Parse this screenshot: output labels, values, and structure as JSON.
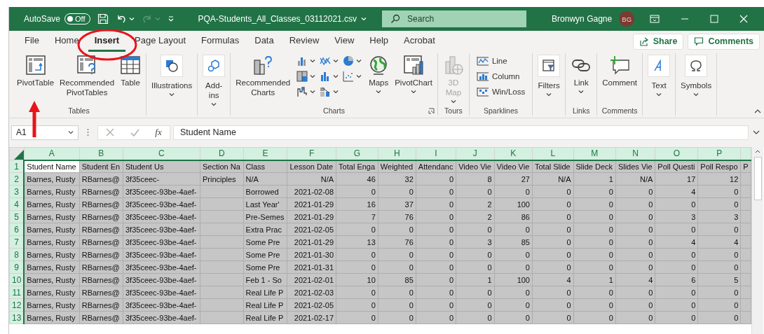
{
  "title_bar": {
    "autosave_label": "AutoSave",
    "autosave_toggle": {
      "label": "Off",
      "on": false
    },
    "filename": "PQA-Students_All_Classes_03112021.csv",
    "search": {
      "placeholder": "Search"
    },
    "user_name": "Bronwyn Gagne",
    "avatar_initials": "BG"
  },
  "tabs": [
    {
      "label": "File",
      "selected": false
    },
    {
      "label": "Home",
      "selected": false
    },
    {
      "label": "Insert",
      "selected": true
    },
    {
      "label": "Page Layout",
      "selected": false
    },
    {
      "label": "Formulas",
      "selected": false
    },
    {
      "label": "Data",
      "selected": false
    },
    {
      "label": "Review",
      "selected": false
    },
    {
      "label": "View",
      "selected": false
    },
    {
      "label": "Help",
      "selected": false
    },
    {
      "label": "Acrobat",
      "selected": false
    }
  ],
  "share_button": "Share",
  "comments_button": "Comments",
  "ribbon": {
    "groups": [
      {
        "label": "Tables",
        "items": [
          {
            "kind": "large",
            "label": "PivotTable",
            "dropdown": false,
            "disabled": false
          },
          {
            "kind": "large",
            "label": "Recommended PivotTables",
            "dropdown": false,
            "disabled": false
          },
          {
            "kind": "large",
            "label": "Table",
            "dropdown": false,
            "disabled": false
          }
        ]
      },
      {
        "items": [
          {
            "kind": "boxed",
            "label": "Illustrations",
            "dropdown": true,
            "disabled": false
          }
        ]
      },
      {
        "items": [
          {
            "kind": "boxed",
            "label": "Add-ins",
            "dropdown": true,
            "disabled": false
          }
        ]
      },
      {
        "label": "Charts",
        "launcher": true,
        "items": [
          {
            "kind": "large",
            "label": "Recommended Charts",
            "dropdown": false,
            "disabled": false
          },
          {
            "kind": "gallery"
          },
          {
            "kind": "large",
            "label": "Maps",
            "dropdown": true,
            "disabled": false
          },
          {
            "kind": "large",
            "label": "PivotChart",
            "dropdown": true,
            "disabled": false
          }
        ]
      },
      {
        "label": "Tours",
        "items": [
          {
            "kind": "large",
            "label": "3D Map",
            "dropdown": true,
            "disabled": true
          }
        ]
      },
      {
        "label": "Sparklines",
        "items": [
          {
            "kind": "small",
            "label": "Line"
          },
          {
            "kind": "small",
            "label": "Column"
          },
          {
            "kind": "small",
            "label": "Win/Loss"
          }
        ]
      },
      {
        "items": [
          {
            "kind": "boxed",
            "label": "Filters",
            "dropdown": true,
            "disabled": false
          }
        ]
      },
      {
        "label": "Links",
        "items": [
          {
            "kind": "large",
            "label": "Link",
            "dropdown": true,
            "disabled": false
          }
        ]
      },
      {
        "label": "Comments",
        "items": [
          {
            "kind": "large",
            "label": "Comment",
            "dropdown": false,
            "disabled": false
          }
        ]
      },
      {
        "items": [
          {
            "kind": "boxed",
            "label": "Text",
            "dropdown": true,
            "disabled": false
          }
        ]
      },
      {
        "items": [
          {
            "kind": "boxed",
            "label": "Symbols",
            "dropdown": true,
            "disabled": false
          }
        ]
      }
    ]
  },
  "formula_bar": {
    "name_box": "A1",
    "function_label": "fx",
    "value": "Student Name"
  },
  "grid": {
    "columns": [
      {
        "letter": "A",
        "selected": true,
        "active": true,
        "numeric": false
      },
      {
        "letter": "B",
        "selected": true,
        "active": false,
        "numeric": false
      },
      {
        "letter": "C",
        "selected": true,
        "active": false,
        "numeric": false
      },
      {
        "letter": "D",
        "selected": true,
        "active": false,
        "numeric": false
      },
      {
        "letter": "E",
        "selected": true,
        "active": false,
        "numeric": false
      },
      {
        "letter": "F",
        "selected": true,
        "active": false,
        "numeric": true
      },
      {
        "letter": "G",
        "selected": true,
        "active": false,
        "numeric": true
      },
      {
        "letter": "H",
        "selected": true,
        "active": false,
        "numeric": true
      },
      {
        "letter": "I",
        "selected": true,
        "active": false,
        "numeric": true
      },
      {
        "letter": "J",
        "selected": true,
        "active": false,
        "numeric": true
      },
      {
        "letter": "K",
        "selected": true,
        "active": false,
        "numeric": true
      },
      {
        "letter": "L",
        "selected": true,
        "active": false,
        "numeric": true
      },
      {
        "letter": "M",
        "selected": true,
        "active": false,
        "numeric": true
      },
      {
        "letter": "N",
        "selected": true,
        "active": false,
        "numeric": true
      },
      {
        "letter": "O",
        "selected": true,
        "active": false,
        "numeric": true
      },
      {
        "letter": "P",
        "selected": true,
        "active": false,
        "numeric": true
      },
      {
        "selected": true,
        "active": false
      }
    ],
    "rows": [
      {
        "number": "1",
        "selected": true,
        "active": true,
        "text_row": true,
        "cells": [
          "Student Name",
          "Student En",
          "Student Us",
          "Section Na",
          "Class",
          "Lesson Date",
          "Total Enga",
          "Weighted",
          "Attendanc",
          "Video Vie",
          "Video Vie",
          "Total Slide",
          "Slide Deck",
          "Slides Vie",
          "Poll Questi",
          "Poll Respo",
          "P"
        ]
      },
      {
        "number": "2",
        "selected": true,
        "active": false,
        "text_row": false,
        "cells": [
          "Barnes, Rusty",
          "RBarnes@",
          "3f35ceec-",
          "Principles",
          "N/A",
          "N/A",
          "46",
          "32",
          "0",
          "8",
          "27",
          "N/A",
          "1",
          "N/A",
          "17",
          "12"
        ]
      },
      {
        "number": "3",
        "selected": true,
        "active": false,
        "text_row": false,
        "cells": [
          "Barnes, Rusty",
          "RBarnes@",
          "3f35ceec-93be-4aef-",
          null,
          "Borrowed",
          "2021-02-08",
          "0",
          "0",
          "0",
          "0",
          "0",
          "0",
          "0",
          "0",
          "4",
          "0"
        ]
      },
      {
        "number": "4",
        "selected": true,
        "active": false,
        "text_row": false,
        "cells": [
          "Barnes, Rusty",
          "RBarnes@",
          "3f35ceec-93be-4aef-",
          null,
          "Last Year'",
          "2021-01-29",
          "16",
          "37",
          "0",
          "2",
          "100",
          "0",
          "0",
          "0",
          "0",
          "0"
        ]
      },
      {
        "number": "5",
        "selected": true,
        "active": false,
        "text_row": false,
        "cells": [
          "Barnes, Rusty",
          "RBarnes@",
          "3f35ceec-93be-4aef-",
          null,
          "Pre-Semes",
          "2021-01-29",
          "7",
          "76",
          "0",
          "2",
          "86",
          "0",
          "0",
          "0",
          "3",
          "3"
        ]
      },
      {
        "number": "6",
        "selected": true,
        "active": false,
        "text_row": false,
        "cells": [
          "Barnes, Rusty",
          "RBarnes@",
          "3f35ceec-93be-4aef-",
          null,
          "Extra Prac",
          "2021-02-05",
          "0",
          "0",
          "0",
          "0",
          "0",
          "0",
          "0",
          "0",
          "0",
          "0"
        ]
      },
      {
        "number": "7",
        "selected": true,
        "active": false,
        "text_row": false,
        "cells": [
          "Barnes, Rusty",
          "RBarnes@",
          "3f35ceec-93be-4aef-",
          null,
          "Some Pre",
          "2021-01-29",
          "13",
          "76",
          "0",
          "3",
          "85",
          "0",
          "0",
          "0",
          "4",
          "4"
        ]
      },
      {
        "number": "8",
        "selected": true,
        "active": false,
        "text_row": false,
        "cells": [
          "Barnes, Rusty",
          "RBarnes@",
          "3f35ceec-93be-4aef-",
          null,
          "Some Pre",
          "2021-01-30",
          "0",
          "0",
          "0",
          "0",
          "0",
          "0",
          "0",
          "0",
          "0",
          "0"
        ]
      },
      {
        "number": "9",
        "selected": true,
        "active": false,
        "text_row": false,
        "cells": [
          "Barnes, Rusty",
          "RBarnes@",
          "3f35ceec-93be-4aef-",
          null,
          "Some Pre",
          "2021-01-31",
          "0",
          "0",
          "0",
          "0",
          "0",
          "0",
          "0",
          "0",
          "0",
          "0"
        ]
      },
      {
        "number": "10",
        "selected": true,
        "active": false,
        "text_row": false,
        "cells": [
          "Barnes, Rusty",
          "RBarnes@",
          "3f35ceec-93be-4aef-",
          null,
          "Feb 1 - So",
          "2021-02-01",
          "10",
          "85",
          "0",
          "1",
          "100",
          "4",
          "1",
          "4",
          "6",
          "5"
        ]
      },
      {
        "number": "11",
        "selected": true,
        "active": false,
        "text_row": false,
        "cells": [
          "Barnes, Rusty",
          "RBarnes@",
          "3f35ceec-93be-4aef-",
          null,
          "Real Life P",
          "2021-02-03",
          "0",
          "0",
          "0",
          "0",
          "0",
          "0",
          "0",
          "0",
          "0",
          "0"
        ]
      },
      {
        "number": "12",
        "selected": true,
        "active": false,
        "text_row": false,
        "cells": [
          "Barnes, Rusty",
          "RBarnes@",
          "3f35ceec-93be-4aef-",
          null,
          "Real Life P",
          "2021-02-05",
          "0",
          "0",
          "0",
          "0",
          "0",
          "0",
          "0",
          "0",
          "0",
          "0"
        ]
      },
      {
        "number": "13",
        "selected": true,
        "active": false,
        "text_row": false,
        "cells": [
          "Barnes, Rusty",
          "RBarnes@",
          "3f35ceec-93be-4aef-",
          null,
          "Real Life P",
          "2021-02-17",
          "0",
          "0",
          "0",
          "0",
          "0",
          "0",
          "0",
          "0",
          "0",
          "0"
        ]
      }
    ]
  }
}
